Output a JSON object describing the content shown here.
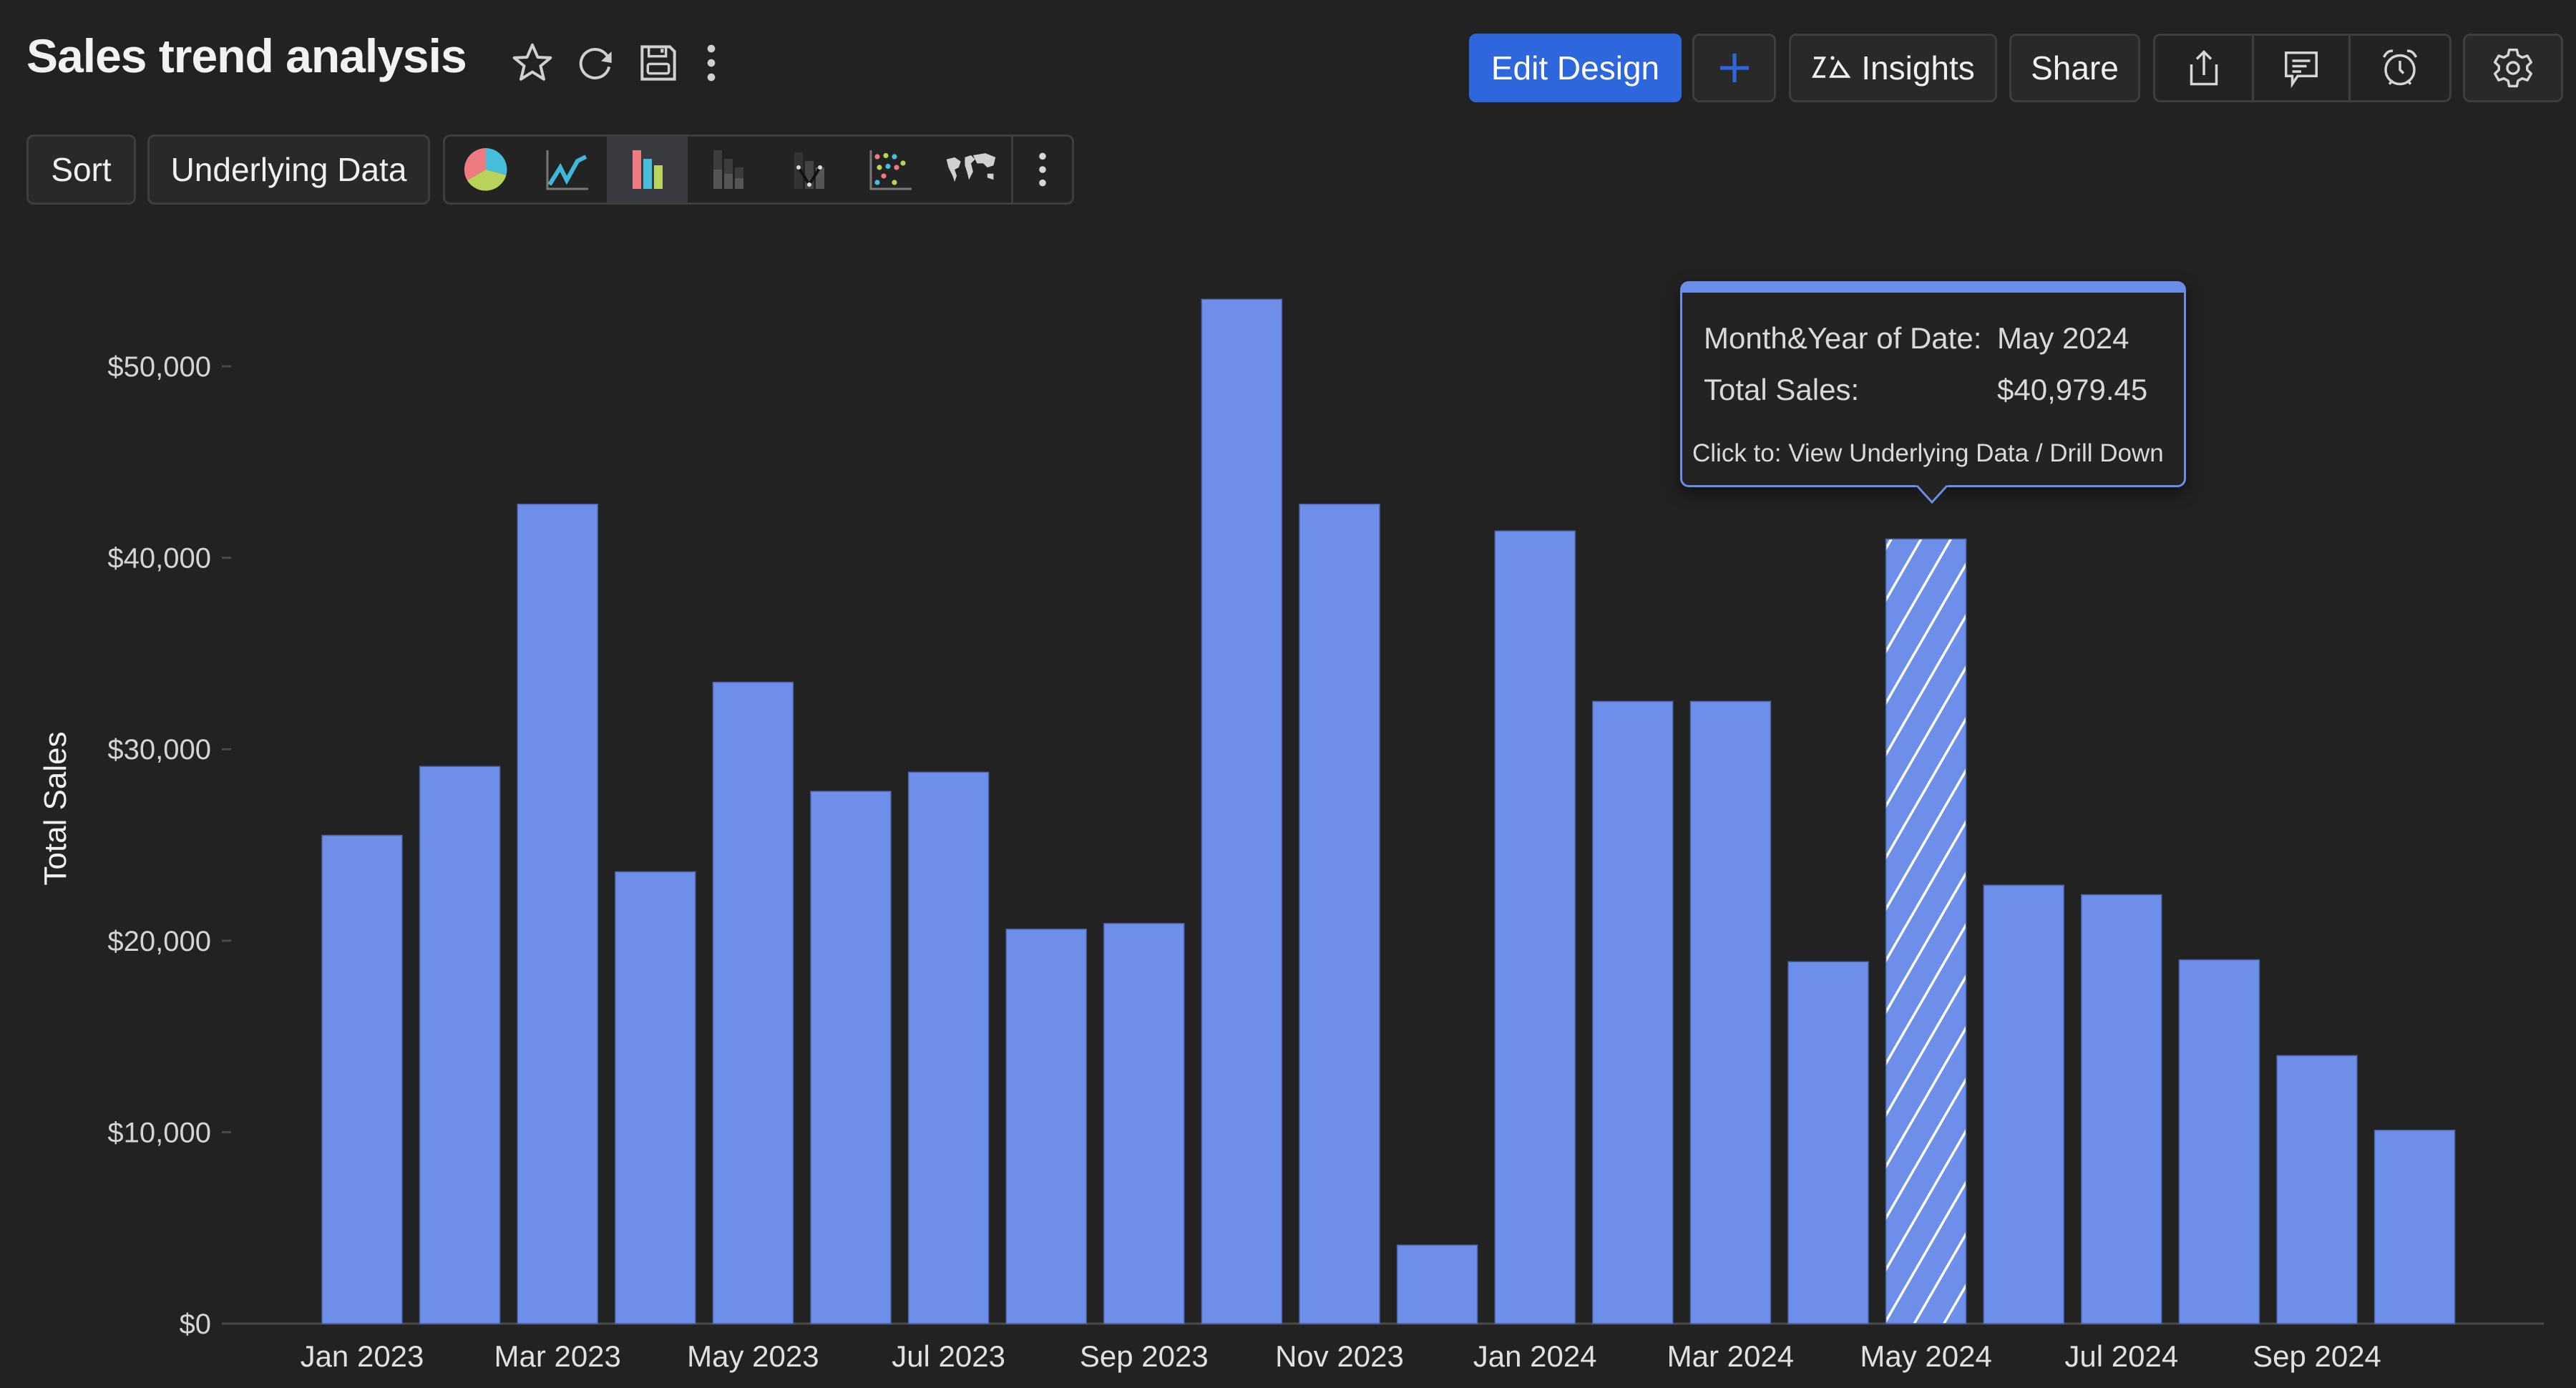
{
  "header": {
    "title": "Sales trend analysis",
    "icons": [
      "star-icon",
      "refresh-icon",
      "save-icon",
      "more-vertical-icon"
    ],
    "buttons": {
      "edit_design": "Edit Design",
      "add": "+",
      "insights": "Insights",
      "share": "Share"
    },
    "icon_buttons": [
      "export-icon",
      "comment-icon",
      "alarm-clock-icon",
      "settings-gear-icon"
    ]
  },
  "toolbar": {
    "sort_label": "Sort",
    "underlying_data_label": "Underlying Data",
    "chart_types": [
      "pie",
      "line",
      "bar",
      "stacked-bar",
      "combination",
      "scatter",
      "map"
    ],
    "selected_chart_type": "bar"
  },
  "colors": {
    "bar": "#6d8fea",
    "accent": "#2e66dd",
    "background": "#222222",
    "tooltip_border": "#6a8de8"
  },
  "tooltip": {
    "dimension_label": "Month&Year of Date:",
    "dimension_value": "May 2024",
    "measure_label": "Total Sales:",
    "measure_value": "$40,979.45",
    "note": "Click to: View Underlying Data / Drill Down"
  },
  "chart_data": {
    "type": "bar",
    "title": "Sales trend analysis",
    "xlabel": "",
    "ylabel": "Total Sales",
    "ylim": [
      0,
      50000
    ],
    "yticks": [
      0,
      10000,
      20000,
      30000,
      40000,
      50000
    ],
    "ytick_labels": [
      "$0",
      "$10,000",
      "$20,000",
      "$30,000",
      "$40,000",
      "$50,000"
    ],
    "grid": false,
    "legend": "none",
    "highlighted_category": "May 2024",
    "categories": [
      "Jan 2023",
      "Feb 2023",
      "Mar 2023",
      "Apr 2023",
      "May 2023",
      "Jun 2023",
      "Jul 2023",
      "Aug 2023",
      "Sep 2023",
      "Oct 2023",
      "Nov 2023",
      "Dec 2023",
      "Jan 2024",
      "Feb 2024",
      "Mar 2024",
      "Apr 2024",
      "May 2024",
      "Jun 2024",
      "Jul 2024",
      "Aug 2024",
      "Sep 2024",
      "Oct 2024"
    ],
    "xtick_labels": [
      "Jan 2023",
      "Mar 2023",
      "May 2023",
      "Jul 2023",
      "Sep 2023",
      "Nov 2023",
      "Jan 2024",
      "Mar 2024",
      "May 2024",
      "Jul 2024",
      "Sep 2024"
    ],
    "series": [
      {
        "name": "Total Sales",
        "values": [
          25500,
          29100,
          42800,
          23600,
          33500,
          27800,
          28800,
          20600,
          20900,
          53500,
          42800,
          4100,
          41400,
          32500,
          32500,
          18900,
          40979.45,
          22900,
          22400,
          19000,
          14000,
          10100
        ]
      }
    ]
  }
}
